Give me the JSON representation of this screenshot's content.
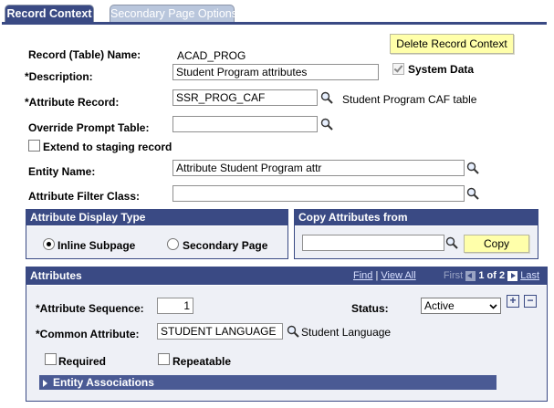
{
  "tabs": {
    "record_context": "Record Context",
    "secondary_page_options": "Secondary Page Options"
  },
  "form": {
    "record_name_label": "Record (Table) Name:",
    "record_name_value": "ACAD_PROG",
    "delete_button": "Delete Record Context",
    "description_label": "*Description:",
    "description_value": "Student Program attributes",
    "system_data_label": "System Data",
    "system_data_checked": true,
    "attribute_record_label": "*Attribute Record:",
    "attribute_record_value": "SSR_PROG_CAF",
    "attribute_record_desc": "Student Program CAF table",
    "override_prompt_label": "Override Prompt Table:",
    "override_prompt_value": "",
    "extend_staging_label": "Extend to staging record",
    "extend_staging_checked": false,
    "entity_name_label": "Entity Name:",
    "entity_name_value": "Attribute Student Program attr",
    "filter_class_label": "Attribute Filter Class:",
    "filter_class_value": ""
  },
  "display_type": {
    "title": "Attribute Display Type",
    "inline_label": "Inline Subpage",
    "secondary_label": "Secondary Page",
    "selected": "inline"
  },
  "copy": {
    "title": "Copy Attributes from",
    "input_value": "",
    "button": "Copy"
  },
  "attributes": {
    "title": "Attributes",
    "find_link": "Find",
    "view_all_link": "View All",
    "first_label": "First",
    "paging": "1 of 2",
    "last_label": "Last",
    "sequence_label": "*Attribute Sequence:",
    "sequence_value": "1",
    "status_label": "Status:",
    "status_value": "Active",
    "common_label": "*Common Attribute:",
    "common_value": "STUDENT LANGUAGE",
    "common_desc": "Student Language",
    "required_label": "Required",
    "repeatable_label": "Repeatable",
    "entity_assoc_label": "Entity Associations",
    "add_row": "+",
    "delete_row": "−"
  },
  "colors": {
    "header_blue": "#3a4a84",
    "button_yellow": "#ffffaa",
    "inactive_tab": "#b9c6dc"
  }
}
